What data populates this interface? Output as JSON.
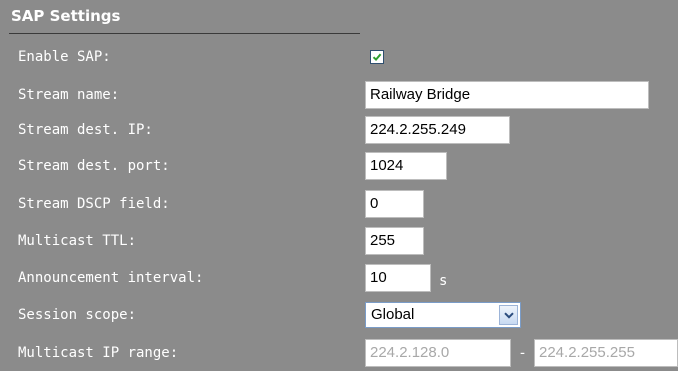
{
  "section": {
    "title": "SAP Settings"
  },
  "fields": {
    "enable_sap": {
      "label": "Enable SAP:",
      "checked": true
    },
    "stream_name": {
      "label": "Stream name:",
      "value": "Railway Bridge"
    },
    "stream_dest_ip": {
      "label": "Stream dest. IP:",
      "value": "224.2.255.249"
    },
    "stream_dest_port": {
      "label": "Stream dest. port:",
      "value": "1024"
    },
    "stream_dscp": {
      "label": "Stream DSCP field:",
      "value": "0"
    },
    "multicast_ttl": {
      "label": "Multicast TTL:",
      "value": "255"
    },
    "announcement_interval": {
      "label": "Announcement interval:",
      "value": "10",
      "unit": "s"
    },
    "session_scope": {
      "label": "Session scope:",
      "selected": "Global"
    },
    "multicast_ip_range": {
      "label": "Multicast IP range:",
      "from": "224.2.128.0",
      "separator": "-",
      "to": "224.2.255.255",
      "disabled": true
    }
  },
  "colors": {
    "panel_bg": "#8b8b8b",
    "text": "#ffffff",
    "checkmark": "#2e9e2e",
    "disabled_text": "#a8a8a8"
  }
}
